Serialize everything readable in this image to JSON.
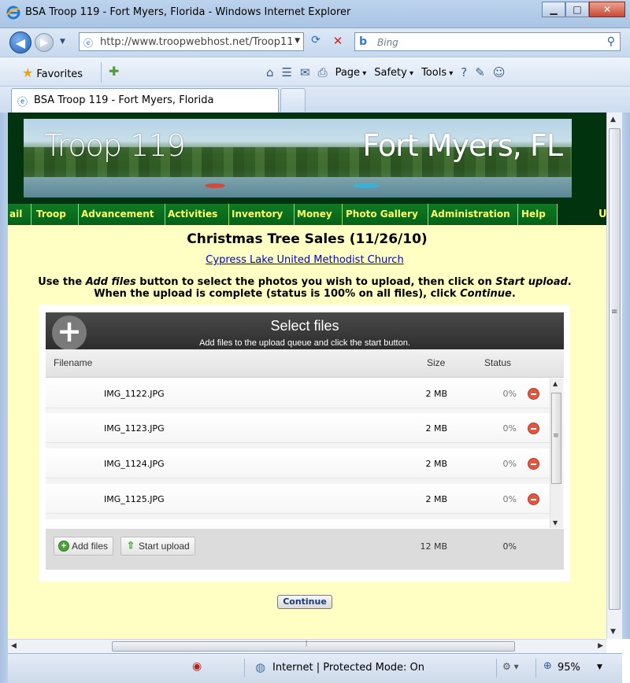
{
  "window": {
    "title": "BSA Troop 119 - Fort Myers, Florida - Windows Internet Explorer",
    "minimize": "▁",
    "maximize": "□",
    "close": "✕"
  },
  "nav": {
    "url": "http://www.troopwebhost.net/Troop11",
    "search_placeholder": "Bing"
  },
  "command_bar": {
    "favorites": "Favorites",
    "page": "Page",
    "safety": "Safety",
    "tools": "Tools"
  },
  "tab": {
    "label": "BSA Troop 119 - Fort Myers, Florida"
  },
  "banner": {
    "left_text": "Troop 119",
    "right_text": "Fort Myers, FL"
  },
  "site_menu": {
    "items": [
      "ail",
      "Troop",
      "Advancement",
      "Activities",
      "Inventory",
      "Money",
      "Photo Gallery",
      "Administration",
      "Help"
    ],
    "trailing": "U"
  },
  "page": {
    "title": "Christmas Tree Sales (11/26/10)",
    "link": "Cypress Lake United Methodist Church",
    "instr_1a": "Use the ",
    "instr_1b": "Add files",
    "instr_1c": " button to select the photos you wish to upload, then click on ",
    "instr_1d": "Start upload",
    "instr_1e": ".",
    "instr_2a": "When the upload is complete (status is 100% on all files), click ",
    "instr_2b": "Continue",
    "instr_2c": ".",
    "continue_label": "Continue"
  },
  "uploader": {
    "title": "Select files",
    "subtitle": "Add files to the upload queue and click the start button.",
    "col_filename": "Filename",
    "col_size": "Size",
    "col_status": "Status",
    "files": [
      {
        "name": "IMG_1122.JPG",
        "size": "2 MB",
        "status": "0%"
      },
      {
        "name": "IMG_1123.JPG",
        "size": "2 MB",
        "status": "0%"
      },
      {
        "name": "IMG_1124.JPG",
        "size": "2 MB",
        "status": "0%"
      },
      {
        "name": "IMG_1125.JPG",
        "size": "2 MB",
        "status": "0%"
      }
    ],
    "add_files": "Add files",
    "start_upload": "Start upload",
    "total_size": "12 MB",
    "total_status": "0%"
  },
  "status_bar": {
    "zone": "Internet | Protected Mode: On",
    "zoom": "95%"
  }
}
